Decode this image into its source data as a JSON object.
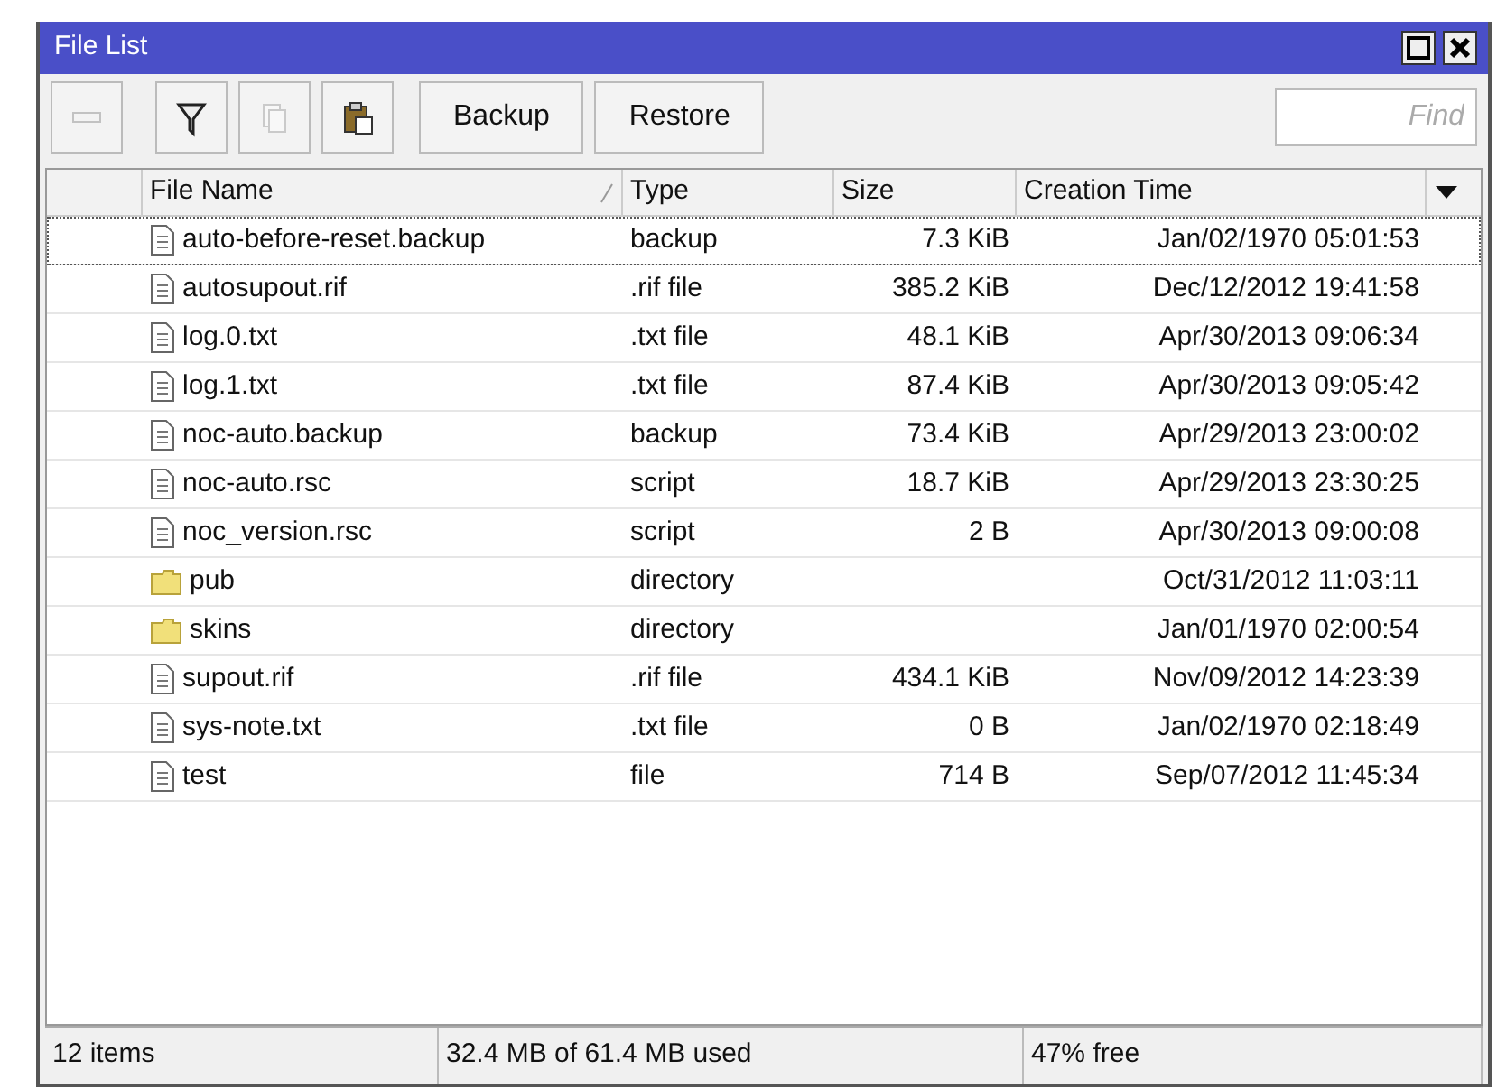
{
  "window": {
    "title": "File List"
  },
  "toolbar": {
    "buttons": [
      {
        "kind": "remove",
        "disabled": true
      },
      {
        "kind": "filter",
        "disabled": false
      },
      {
        "kind": "copy",
        "disabled": true
      },
      {
        "kind": "paste",
        "disabled": false
      }
    ],
    "text_buttons": [
      "Backup",
      "Restore"
    ],
    "search": {
      "placeholder": "Find"
    }
  },
  "table": {
    "columns": [
      "File Name",
      "Type",
      "Size",
      "Creation Time"
    ],
    "rows": [
      {
        "kind": "file",
        "selected": true,
        "name": "auto-before-reset.backup",
        "type": "backup",
        "size": "7.3 KiB",
        "time": "Jan/02/1970 05:01:53"
      },
      {
        "kind": "file",
        "selected": false,
        "name": "autosupout.rif",
        "type": ".rif file",
        "size": "385.2 KiB",
        "time": "Dec/12/2012 19:41:58"
      },
      {
        "kind": "file",
        "selected": false,
        "name": "log.0.txt",
        "type": ".txt file",
        "size": "48.1 KiB",
        "time": "Apr/30/2013 09:06:34"
      },
      {
        "kind": "file",
        "selected": false,
        "name": "log.1.txt",
        "type": ".txt file",
        "size": "87.4 KiB",
        "time": "Apr/30/2013 09:05:42"
      },
      {
        "kind": "file",
        "selected": false,
        "name": "noc-auto.backup",
        "type": "backup",
        "size": "73.4 KiB",
        "time": "Apr/29/2013 23:00:02"
      },
      {
        "kind": "file",
        "selected": false,
        "name": "noc-auto.rsc",
        "type": "script",
        "size": "18.7 KiB",
        "time": "Apr/29/2013 23:30:25"
      },
      {
        "kind": "file",
        "selected": false,
        "name": "noc_version.rsc",
        "type": "script",
        "size": "2 B",
        "time": "Apr/30/2013 09:00:08"
      },
      {
        "kind": "directory",
        "selected": false,
        "name": "pub",
        "type": "directory",
        "time": "Oct/31/2012 11:03:11"
      },
      {
        "kind": "directory",
        "selected": false,
        "name": "skins",
        "type": "directory",
        "time": "Jan/01/1970 02:00:54"
      },
      {
        "kind": "file",
        "selected": false,
        "name": "supout.rif",
        "type": ".rif file",
        "size": "434.1 KiB",
        "time": "Nov/09/2012 14:23:39"
      },
      {
        "kind": "file",
        "selected": false,
        "name": "sys-note.txt",
        "type": ".txt file",
        "size": "0 B",
        "time": "Jan/02/1970 02:18:49"
      },
      {
        "kind": "file",
        "selected": false,
        "name": "test",
        "type": "file",
        "size": "714 B",
        "time": "Sep/07/2012 11:45:34"
      }
    ]
  },
  "status_bar": [
    "12 items",
    "32.4 MB of 61.4 MB used",
    "47% free"
  ]
}
